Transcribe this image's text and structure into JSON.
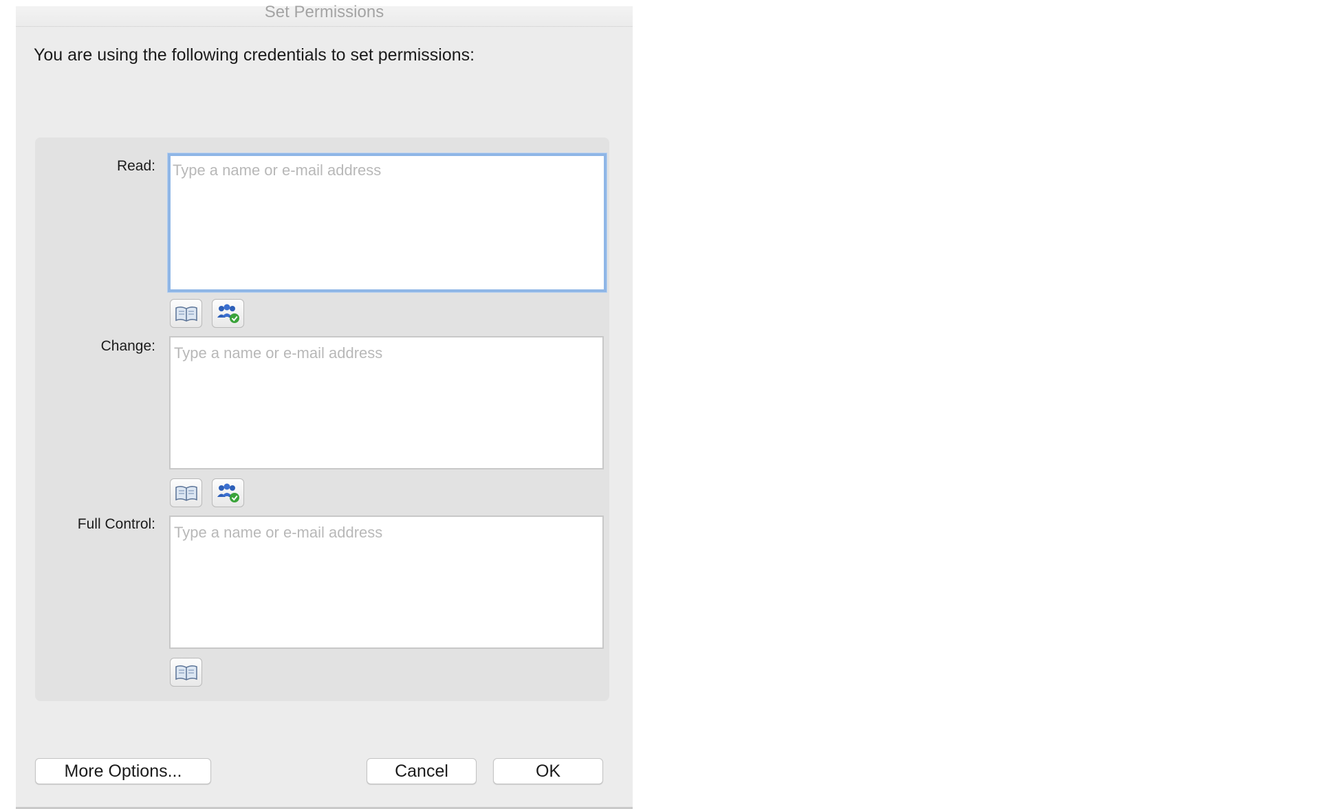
{
  "dialog": {
    "title": "Set Permissions",
    "credentials_text": "You are using the following credentials to set permissions:"
  },
  "permissions": {
    "read": {
      "label": "Read:",
      "value": "",
      "placeholder": "Type a name or e-mail address",
      "focused": true,
      "buttons": [
        "address-book-icon",
        "check-names-icon"
      ]
    },
    "change": {
      "label": "Change:",
      "value": "",
      "placeholder": "Type a name or e-mail address",
      "buttons": [
        "address-book-icon",
        "check-names-icon"
      ]
    },
    "full_control": {
      "label": "Full Control:",
      "value": "",
      "placeholder": "Type a name or e-mail address",
      "buttons": [
        "address-book-icon"
      ]
    }
  },
  "buttons": {
    "more_options": "More Options...",
    "cancel": "Cancel",
    "ok": "OK"
  },
  "colors": {
    "focus_ring": "#8fb6e6",
    "panel": "#e2e2e2",
    "dialog": "#ececec",
    "check_green": "#3aa33a",
    "people_blue": "#2d5fb8"
  }
}
